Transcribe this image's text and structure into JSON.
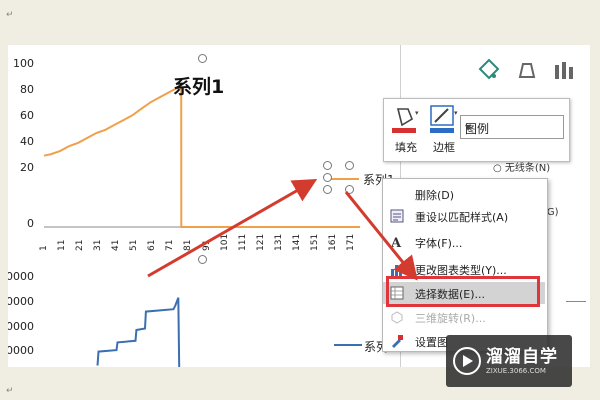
{
  "chart_data": [
    {
      "type": "line",
      "title": "系列1",
      "ylim": [
        0,
        100
      ],
      "yticks": [
        "100",
        "80",
        "60",
        "40",
        "20",
        "0"
      ],
      "categories": [
        "1",
        "11",
        "21",
        "31",
        "41",
        "51",
        "61",
        "71",
        "81",
        "91",
        "101",
        "111",
        "121",
        "131",
        "141",
        "151",
        "161",
        "171"
      ],
      "series": [
        {
          "name": "系列1",
          "color": "#f0a04b",
          "x": [
            1,
            5,
            10,
            15,
            20,
            25,
            30,
            35,
            40,
            45,
            50,
            55,
            60,
            65,
            70,
            75,
            77,
            77.01,
            80,
            90,
            100,
            110,
            120,
            130,
            140,
            150,
            160,
            170,
            176
          ],
          "values": [
            44,
            45,
            47,
            50,
            52,
            55,
            58,
            60,
            63,
            66,
            69,
            73,
            77,
            80,
            83,
            86,
            88,
            0,
            0,
            0,
            0,
            0,
            0,
            0,
            0,
            0,
            0,
            0,
            0
          ]
        }
      ]
    },
    {
      "type": "line",
      "yticks": [
        "0000",
        "0000",
        "0000",
        "0000"
      ],
      "series": [
        {
          "name": "系列1",
          "color": "#3a6fb0",
          "points": [
            [
              0.1,
              0.02
            ],
            [
              0.11,
              0.2
            ],
            [
              0.3,
              0.22
            ],
            [
              0.31,
              0.32
            ],
            [
              0.5,
              0.34
            ],
            [
              0.51,
              0.48
            ],
            [
              0.6,
              0.5
            ],
            [
              0.61,
              0.72
            ],
            [
              0.9,
              0.75
            ],
            [
              0.92,
              0.8
            ],
            [
              0.95,
              0.9
            ],
            [
              0.96,
              0.0
            ]
          ]
        }
      ]
    }
  ],
  "legend_label": "系列1",
  "mini_toolbar": {
    "fill_label": "填充",
    "border_label": "边框",
    "dropdown_value": "图例",
    "fill_color": "#d6312f",
    "border_color": "#2b6cc4"
  },
  "format_pane_fragments": {
    "no_line": "○ 无线条(N)",
    "g": "(G)"
  },
  "context_menu": {
    "items": [
      {
        "label": "删除(D)",
        "icon": "",
        "disabled": false
      },
      {
        "label": "重设以匹配样式(A)",
        "icon": "reset-style-icon",
        "disabled": false
      },
      {
        "label": "字体(F)...",
        "icon": "font-icon",
        "disabled": false
      },
      {
        "label": "更改图表类型(Y)...",
        "icon": "chart-type-icon",
        "disabled": false
      },
      {
        "label": "选择数据(E)...",
        "icon": "select-data-icon",
        "disabled": false,
        "highlight": true
      },
      {
        "label": "三维旋转(R)...",
        "icon": "3d-rotate-icon",
        "disabled": true
      },
      {
        "label": "设置图",
        "icon": "format-icon",
        "disabled": false
      }
    ]
  },
  "watermark": {
    "title": "溜溜自学",
    "subtitle": "ZIXUE.3066.COM"
  },
  "colors": {
    "arrow": "#d33b2f",
    "highlight_border": "#e0353a"
  }
}
